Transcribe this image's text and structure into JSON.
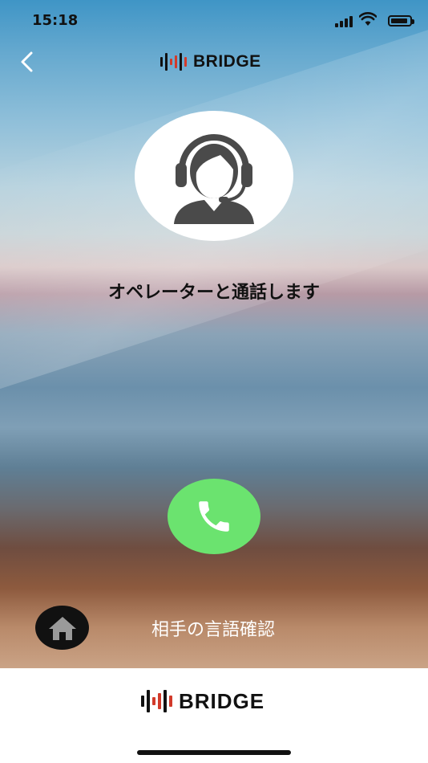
{
  "status_bar": {
    "time": "15:18",
    "signal_icon": "cellular-signal-icon",
    "wifi_icon": "wifi-icon",
    "battery_icon": "battery-icon"
  },
  "header": {
    "back_icon": "chevron-left-icon",
    "logo_text": "BRIDGE"
  },
  "main": {
    "avatar_icon": "operator-headset-icon",
    "message": "オペレーターと通話します",
    "call_icon": "phone-icon",
    "call_button_color": "#6be36f"
  },
  "bottom_controls": {
    "home_icon": "home-icon",
    "language_check_label": "相手の言語確認"
  },
  "footer": {
    "logo_text": "BRIDGE"
  },
  "colors": {
    "logo_accent": "#d23a2a",
    "text_dark": "#111111"
  }
}
